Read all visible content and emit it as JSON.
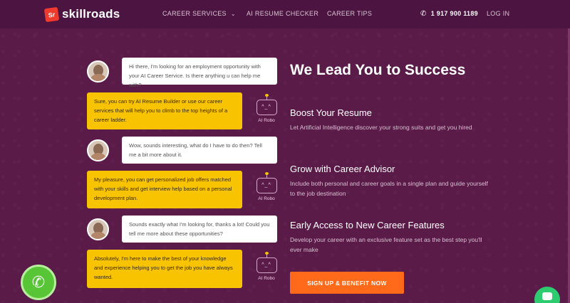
{
  "header": {
    "logo_mark": "Sr",
    "logo_text": "skillroads",
    "nav": {
      "career_services": "CAREER SERVICES",
      "ai_resume_checker": "AI RESUME CHECKER",
      "career_tips": "CAREER TIPS",
      "phone": "1 917 900 1189",
      "login": "LOG IN"
    }
  },
  "chat": {
    "messages": [
      {
        "from": "user",
        "text": "Hi there, I'm looking for an employment opportunity with your AI Career Service. Is there anything u can help me with?"
      },
      {
        "from": "bot",
        "text": "Sure, you can try AI Resume Builder or use our career services that will help you to climb to the top heights of a career ladder."
      },
      {
        "from": "user",
        "text": "Wow, sounds interesting, what do I have to do then? Tell me a bit more about it."
      },
      {
        "from": "bot",
        "text": "My pleasure, you can get personalized job offers matched with your skills and get interview help based on a personal development plan."
      },
      {
        "from": "user",
        "text": "Sounds exactly what I'm looking for, thanks a lot! Could you tell me more about these opportunities?"
      },
      {
        "from": "bot",
        "text": "Absolutely, I'm here to make the best of your knowledge and experience helping you to get the job you have always wanted."
      }
    ],
    "robo_face": "^_^",
    "robo_label": "AI Robo"
  },
  "main": {
    "title": "We Lead You to Success",
    "features": [
      {
        "title": "Boost Your Resume",
        "desc": "Let Artificial Intelligence discover your strong suits and get you hired"
      },
      {
        "title": "Grow with Career Advisor",
        "desc": "Include both personal and career goals in a single plan and guide yourself to the job destination"
      },
      {
        "title": "Early Access to New Career Features",
        "desc": "Develop your career with an exclusive feature set as the best step you'll ever make"
      }
    ],
    "cta": "SIGN UP & BENEFIT NOW"
  },
  "colors": {
    "background": "#5b1b49",
    "header": "#4c1541",
    "bot_bubble": "#f8c300",
    "cta": "#ff6a1a",
    "call_button": "#57c535"
  },
  "icons": {
    "call": "phone-call-icon",
    "chat": "chat-bubble-icon",
    "phone": "phone-icon",
    "chevron": "chevron-down-icon"
  }
}
